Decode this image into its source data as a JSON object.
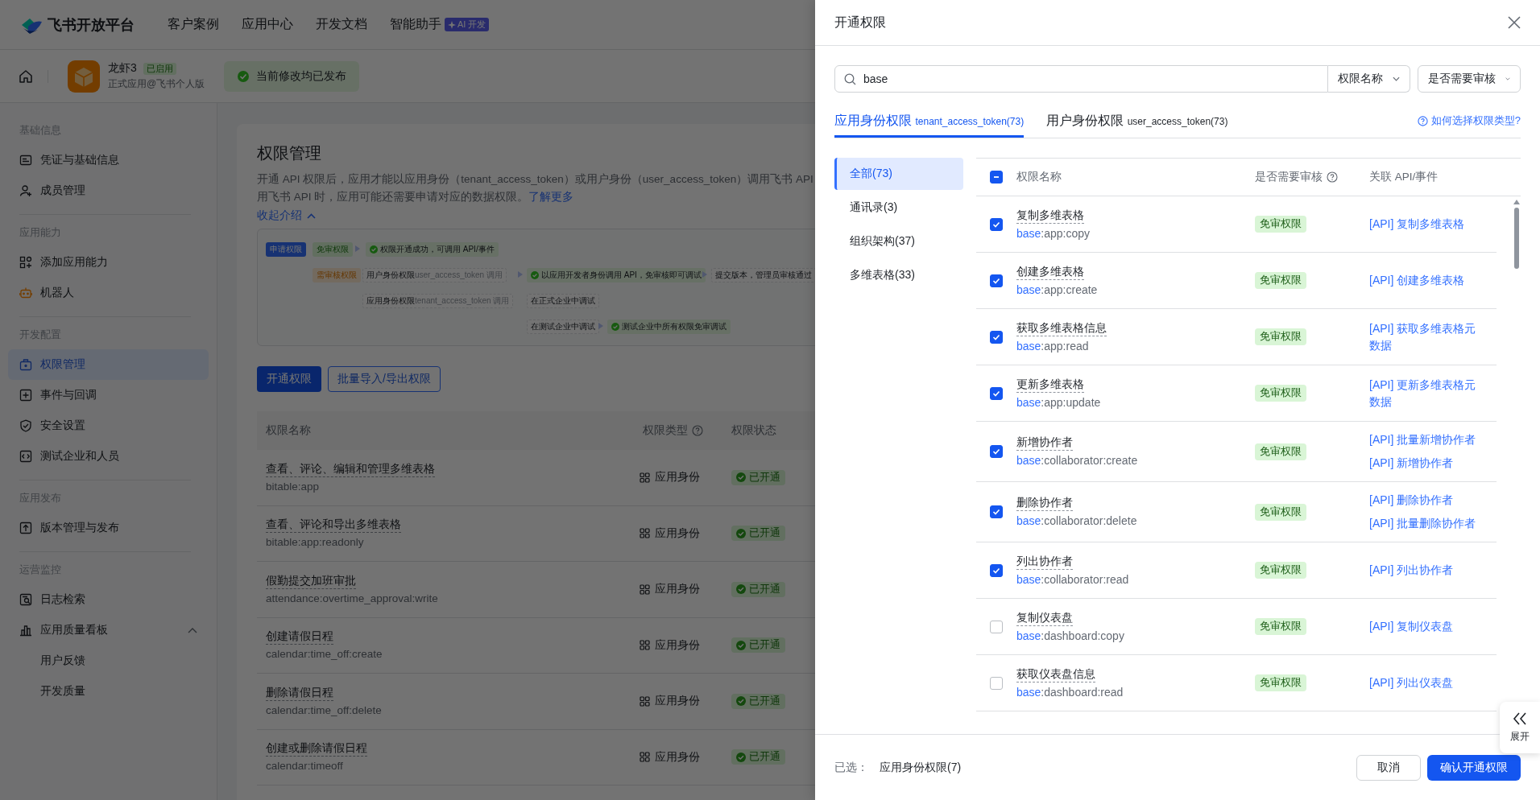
{
  "header": {
    "brand": "飞书开放平台",
    "nav": [
      {
        "label": "客户案例"
      },
      {
        "label": "应用中心"
      },
      {
        "label": "开发文档"
      },
      {
        "label": "智能助手",
        "badge": "AI 开发"
      }
    ]
  },
  "app_bar": {
    "app_name": "龙虾3",
    "status": "已启用",
    "subtitle": "正式应用@飞书个人版",
    "notice": "当前修改均已发布"
  },
  "sidebar": {
    "sections": [
      {
        "title": "基础信息",
        "items": [
          {
            "label": "凭证与基础信息",
            "kind": "credential",
            "selected": false
          },
          {
            "label": "成员管理",
            "kind": "member",
            "selected": false
          }
        ]
      },
      {
        "title": "应用能力",
        "items": [
          {
            "label": "添加应用能力",
            "kind": "ability",
            "selected": false
          },
          {
            "label": "机器人",
            "kind": "robot",
            "selected": false
          }
        ]
      },
      {
        "title": "开发配置",
        "items": [
          {
            "label": "权限管理",
            "kind": "permission",
            "selected": true
          },
          {
            "label": "事件与回调",
            "kind": "event",
            "selected": false
          },
          {
            "label": "安全设置",
            "kind": "security",
            "selected": false
          },
          {
            "label": "测试企业和人员",
            "kind": "test",
            "selected": false
          }
        ]
      },
      {
        "title": "应用发布",
        "items": [
          {
            "label": "版本管理与发布",
            "kind": "version",
            "selected": false
          }
        ]
      },
      {
        "title": "运营监控",
        "items": [
          {
            "label": "日志检索",
            "kind": "log",
            "selected": false
          },
          {
            "label": "应用质量看板",
            "kind": "quality",
            "selected": false,
            "expanded": true,
            "children": [
              {
                "label": "用户反馈",
                "selected": false
              },
              {
                "label": "开发质量",
                "selected": false
              }
            ]
          }
        ]
      }
    ]
  },
  "page": {
    "title": "权限管理",
    "description_lines": [
      "开通 API 权限后，应用才能以应用身份（tenant_access_token）或用户身份（user_access_token）调用飞书 API",
      "用飞书 API 时，应用可能还需要申请对应的数据权限。"
    ],
    "learn_more_link": "了解更多",
    "collapse_link": "收起介绍",
    "diagram": {
      "nodes": [
        {
          "kind": "primary",
          "text": "申请权限"
        },
        {
          "kind": "success",
          "text": "免审权限"
        },
        {
          "kind": "success_check",
          "text": "权限开通成功，可调用 API/事件"
        },
        {
          "kind": "warning",
          "text": "需审核权限"
        },
        {
          "kind": "plain",
          "text": "用户身份权限",
          "note": "user_access_token 调用"
        },
        {
          "kind": "success_check",
          "text": "以应用开发者身份调用 API，免审核即可调试"
        },
        {
          "kind": "plain",
          "text": "提交版本，管理员审核通过"
        },
        {
          "kind": "plain",
          "text": "应用身份权限",
          "note": "tenant_access_token 调用"
        },
        {
          "kind": "plain",
          "text": "在正式企业中调试"
        },
        {
          "kind": "plain",
          "text": "在测试企业中调试"
        },
        {
          "kind": "success_check",
          "text": "测试企业中所有权限免审调试"
        }
      ]
    },
    "buttons": [
      {
        "label": "开通权限",
        "kind": "primary"
      },
      {
        "label": "批量导入/导出权限",
        "kind": "outline"
      }
    ],
    "table": {
      "columns": [
        {
          "label": "权限名称"
        },
        {
          "label": "权限类型",
          "help": true
        },
        {
          "label": "权限状态"
        }
      ],
      "rows": [
        {
          "name": "查看、评论、编辑和管理多维表格",
          "scope": "bitable:app",
          "type": "应用身份",
          "status": "已开通"
        },
        {
          "name": "查看、评论和导出多维表格",
          "scope": "bitable:app:readonly",
          "type": "应用身份",
          "status": "已开通"
        },
        {
          "name": "假勤提交加班审批",
          "scope": "attendance:overtime_approval:write",
          "type": "应用身份",
          "status": "已开通"
        },
        {
          "name": "创建请假日程",
          "scope": "calendar:time_off:create",
          "type": "应用身份",
          "status": "已开通"
        },
        {
          "name": "删除请假日程",
          "scope": "calendar:time_off:delete",
          "type": "应用身份",
          "status": "已开通"
        },
        {
          "name": "创建或删除请假日程",
          "scope": "calendar:timeoff",
          "type": "应用身份",
          "status": "已开通"
        }
      ]
    }
  },
  "drawer": {
    "title": "开通权限",
    "search": {
      "value": "base",
      "field_select": "权限名称",
      "review_select": "是否需要审核"
    },
    "tabs": [
      {
        "label": "应用身份权限",
        "token": "tenant_access_token(73)",
        "selected": true
      },
      {
        "label": "用户身份权限",
        "token": "user_access_token(73)",
        "selected": false
      }
    ],
    "help_link": "如何选择权限类型?",
    "categories": [
      {
        "label": "全部(73)",
        "selected": true
      },
      {
        "label": "通讯录(3)",
        "selected": false
      },
      {
        "label": "组织架构(37)",
        "selected": false
      },
      {
        "label": "多维表格(33)",
        "selected": false
      }
    ],
    "table": {
      "select_all": {
        "indeterminate": true
      },
      "columns": [
        {
          "label": "权限名称"
        },
        {
          "label": "是否需要审核",
          "help": true
        },
        {
          "label": "关联 API/事件"
        }
      ],
      "rows": [
        {
          "checked": true,
          "name": "复制多维表格",
          "match": "base",
          "scope": ":app:copy",
          "review": "免审权限",
          "apis": [
            "[API] 复制多维表格"
          ]
        },
        {
          "checked": true,
          "name": "创建多维表格",
          "match": "base",
          "scope": ":app:create",
          "review": "免审权限",
          "apis": [
            "[API] 创建多维表格"
          ]
        },
        {
          "checked": true,
          "name": "获取多维表格信息",
          "match": "base",
          "scope": ":app:read",
          "review": "免审权限",
          "apis": [
            "[API] 获取多维表格元数据"
          ]
        },
        {
          "checked": true,
          "name": "更新多维表格",
          "match": "base",
          "scope": ":app:update",
          "review": "免审权限",
          "apis": [
            "[API] 更新多维表格元数据"
          ]
        },
        {
          "checked": true,
          "name": "新增协作者",
          "match": "base",
          "scope": ":collaborator:create",
          "review": "免审权限",
          "apis": [
            "[API] 批量新增协作者",
            "[API] 新增协作者"
          ]
        },
        {
          "checked": true,
          "name": "删除协作者",
          "match": "base",
          "scope": ":collaborator:delete",
          "review": "免审权限",
          "apis": [
            "[API] 删除协作者",
            "[API] 批量删除协作者"
          ]
        },
        {
          "checked": true,
          "name": "列出协作者",
          "match": "base",
          "scope": ":collaborator:read",
          "review": "免审权限",
          "apis": [
            "[API] 列出协作者"
          ]
        },
        {
          "checked": false,
          "name": "复制仪表盘",
          "match": "base",
          "scope": ":dashboard:copy",
          "review": "免审权限",
          "apis": [
            "[API] 复制仪表盘"
          ]
        },
        {
          "checked": false,
          "name": "获取仪表盘信息",
          "match": "base",
          "scope": ":dashboard:read",
          "review": "免审权限",
          "apis": [
            "[API] 列出仪表盘"
          ]
        }
      ]
    },
    "footer": {
      "selected_label": "已选：",
      "selected_value": "应用身份权限(7)",
      "buttons": [
        {
          "label": "取消",
          "kind": "secondary"
        },
        {
          "label": "确认开通权限",
          "kind": "primary"
        }
      ]
    },
    "expand_tab": {
      "label": "展开"
    }
  }
}
